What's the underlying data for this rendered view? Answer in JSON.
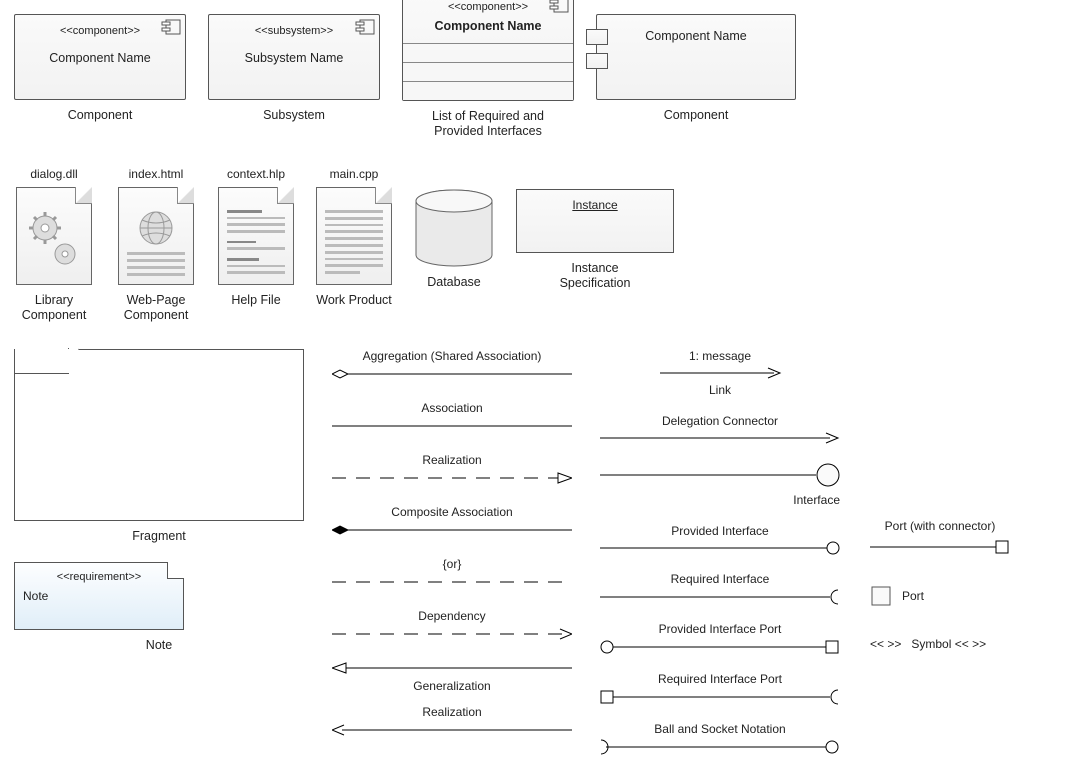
{
  "row1": {
    "component": {
      "stereotype": "<<component>>",
      "name": "Component Name",
      "caption": "Component"
    },
    "subsystem": {
      "stereotype": "<<subsystem>>",
      "name": "Subsystem Name",
      "caption": "Subsystem"
    },
    "listcomp": {
      "stereotype": "<<component>>",
      "name": "Component Name",
      "caption": "List of Required and Provided Interfaces"
    },
    "portcomp": {
      "name": "Component Name",
      "caption": "Component"
    }
  },
  "row2": {
    "lib": {
      "file": "dialog.dll",
      "caption": "Library Component"
    },
    "web": {
      "file": "index.html",
      "caption": "Web-Page Component"
    },
    "help": {
      "file": "context.hlp",
      "caption": "Help File"
    },
    "work": {
      "file": "main.cpp",
      "caption": "Work Product"
    },
    "db": {
      "caption": "Database"
    },
    "inst": {
      "name": "Instance",
      "caption": "Instance Specification"
    }
  },
  "frag": {
    "caption": "Fragment"
  },
  "note": {
    "stereotype": "<<requirement>>",
    "body": "Note",
    "caption": "Note"
  },
  "conn1": {
    "agg": "Aggregation (Shared Association)",
    "assoc": "Association",
    "real": "Realization",
    "comp": "Composite Association",
    "or": "{or}",
    "dep": "Dependency",
    "gen": "Generalization",
    "real2": "Realization"
  },
  "conn2": {
    "msg": "1: message",
    "link": "Link",
    "deleg": "Delegation Connector",
    "iface": "Interface",
    "prov": "Provided Interface",
    "req": "Required Interface",
    "provport": "Provided Interface Port",
    "reqport": "Required Interface Port",
    "ball": "Ball and Socket Notation"
  },
  "side": {
    "portconn": "Port (with connector)",
    "port": "Port",
    "symbol_left": "<< >>",
    "symbol_right": "Symbol << >>"
  }
}
